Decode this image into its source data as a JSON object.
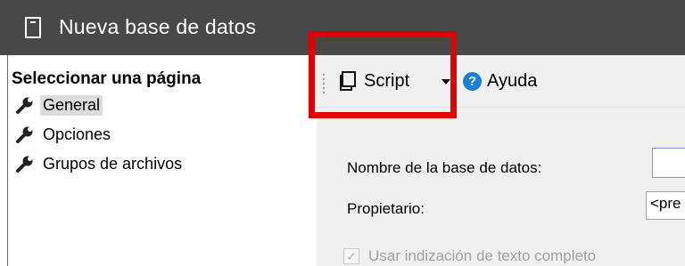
{
  "window": {
    "title": "Nueva base de datos",
    "icon": "document-icon"
  },
  "left_pane": {
    "header": "Seleccionar una página",
    "pages": [
      {
        "label": "General",
        "icon": "wrench-icon",
        "selected": true
      },
      {
        "label": "Opciones",
        "icon": "wrench-icon",
        "selected": false
      },
      {
        "label": "Grupos de archivos",
        "icon": "wrench-icon",
        "selected": false
      }
    ]
  },
  "toolbar": {
    "script_label": "Script",
    "help_label": "Ayuda",
    "script_icon": "script-icon",
    "help_icon": "help-icon"
  },
  "form": {
    "db_name_label": "Nombre de la base de datos:",
    "db_name_value": "",
    "owner_label": "Propietario:",
    "owner_value": "<pre",
    "fulltext_label": "Usar indización de texto completo",
    "fulltext_checked": true
  },
  "colors": {
    "titlebar": "#484848",
    "highlight": "#e00000",
    "help_icon": "#1c7fd4"
  }
}
